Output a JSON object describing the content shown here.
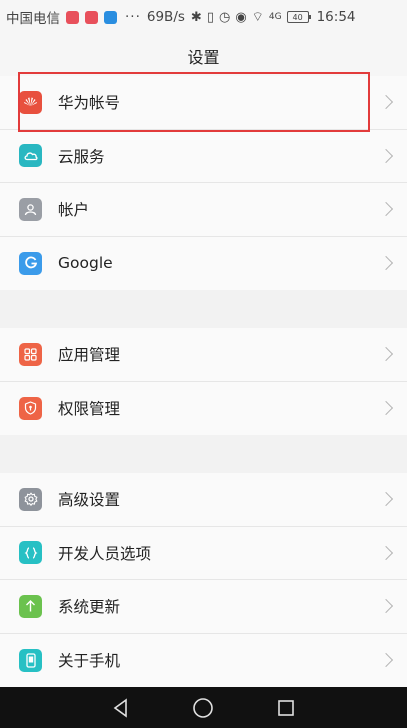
{
  "status_bar": {
    "carrier": "中国电信",
    "dots": "···",
    "speed": "69B/s",
    "time": "16:54",
    "battery": "40",
    "network_label": "4G",
    "app_colors": [
      "#e8505b",
      "#e8505b",
      "#2a8ee0"
    ]
  },
  "header": {
    "title": "设置"
  },
  "groups": [
    [
      {
        "label": "华为帐号",
        "icon": "huawei-logo-icon",
        "color": "#e8503e"
      },
      {
        "label": "云服务",
        "icon": "cloud-icon",
        "color": "#29b7c1"
      },
      {
        "label": "帐户",
        "icon": "person-icon",
        "color": "#9a9ea5"
      },
      {
        "label": "Google",
        "icon": "google-g-icon",
        "color": "#3b9bea"
      }
    ],
    [
      {
        "label": "应用管理",
        "icon": "grid-icon",
        "color": "#ee6446"
      },
      {
        "label": "权限管理",
        "icon": "shield-icon",
        "color": "#ee6446"
      }
    ],
    [
      {
        "label": "高级设置",
        "icon": "gear-icon",
        "color": "#8e939b"
      },
      {
        "label": "开发人员选项",
        "icon": "braces-icon",
        "color": "#27c0c4"
      },
      {
        "label": "系统更新",
        "icon": "arrow-up-icon",
        "color": "#6bc24e"
      },
      {
        "label": "关于手机",
        "icon": "phone-icon",
        "color": "#27c0c4"
      }
    ]
  ],
  "nav": {
    "buttons": [
      "back-icon",
      "home-icon",
      "recents-icon"
    ]
  }
}
